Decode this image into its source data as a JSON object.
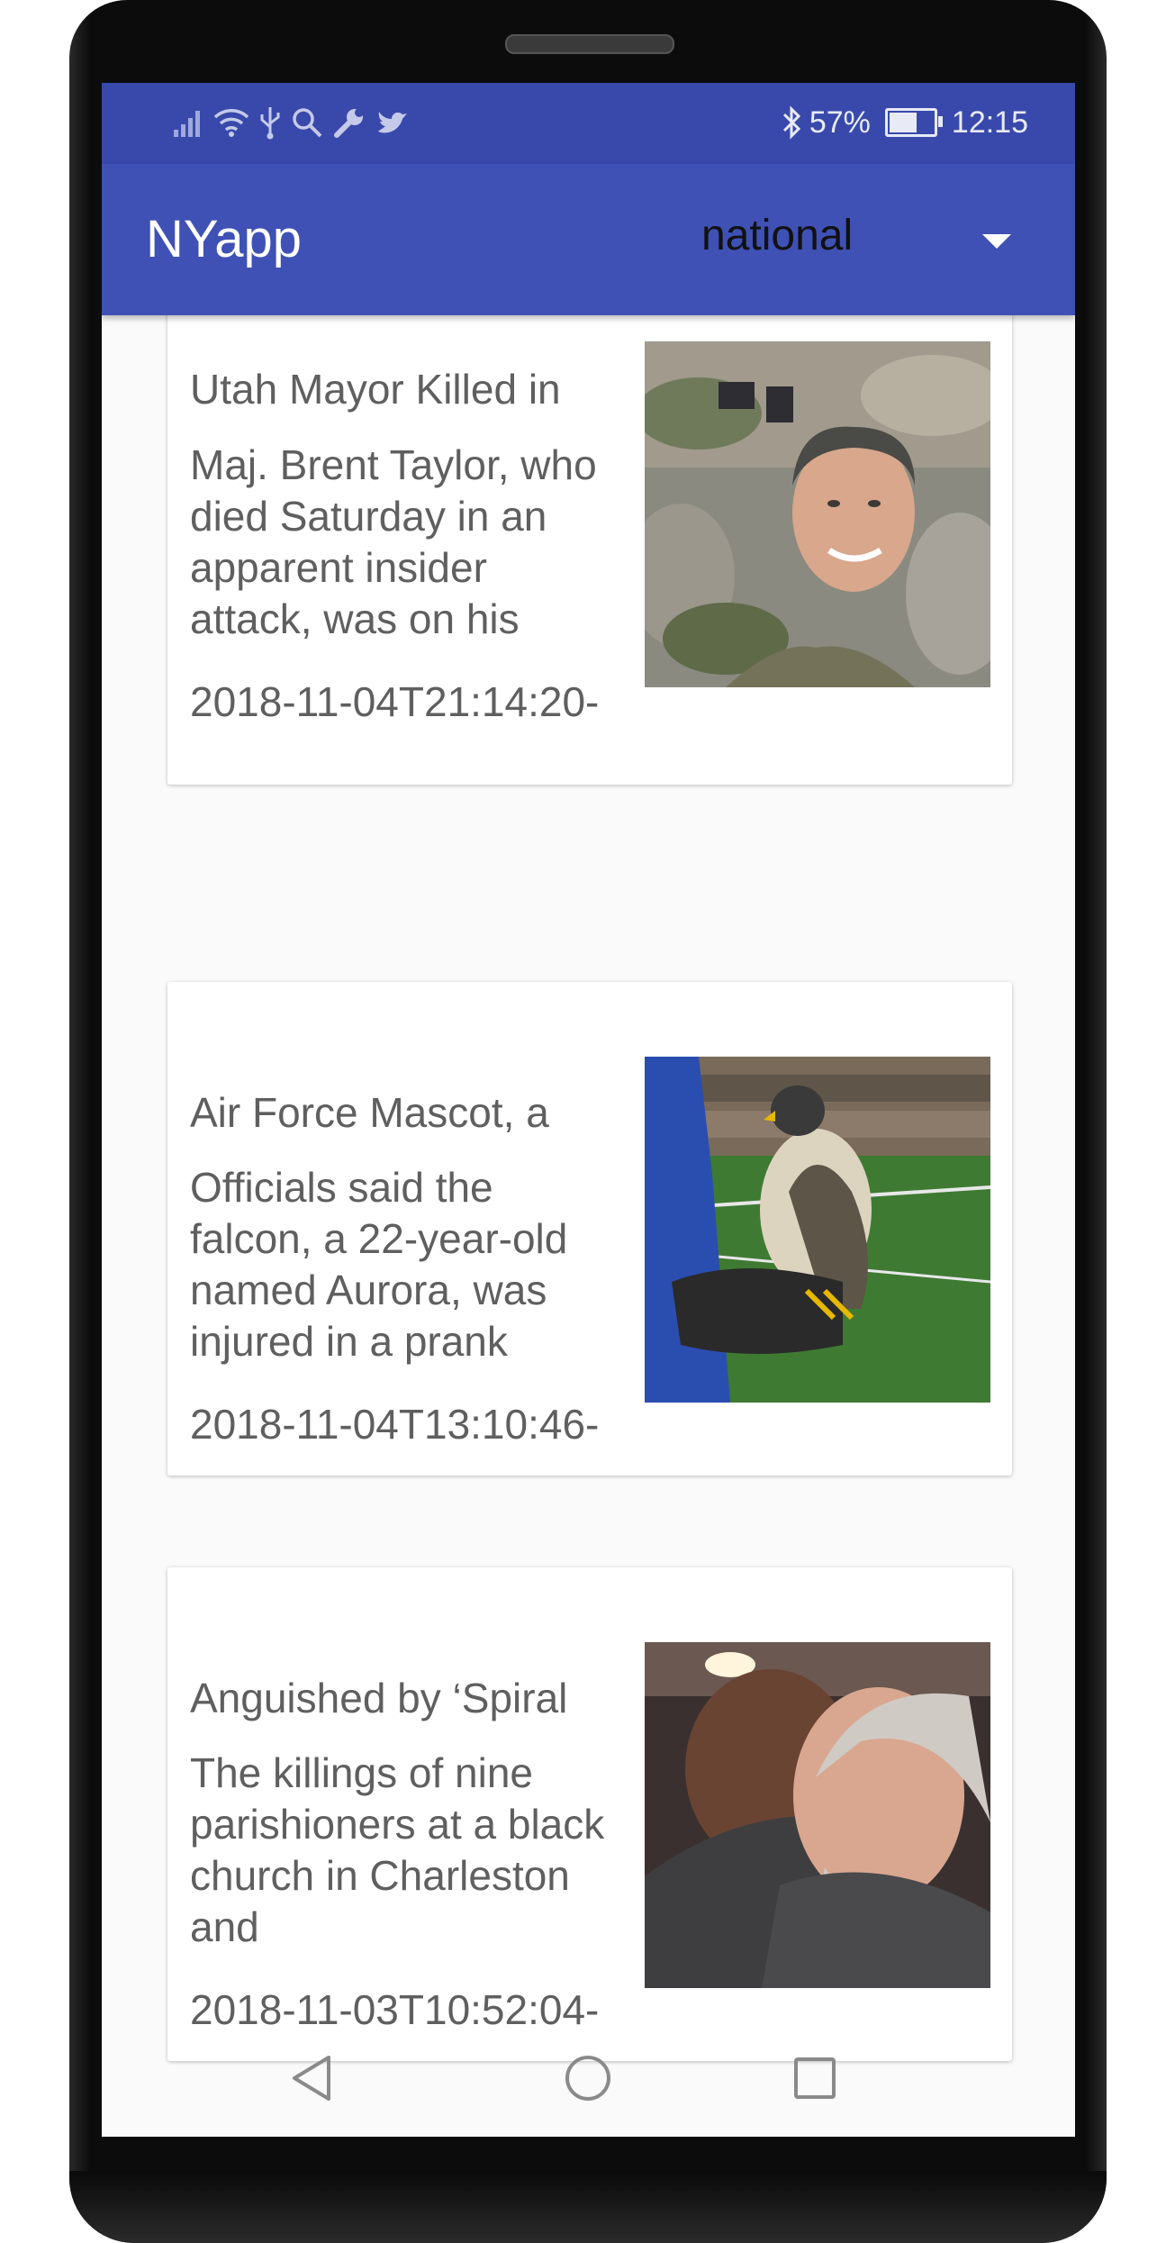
{
  "status_bar": {
    "battery_percent": "57%",
    "battery_level": 0.57,
    "time": "12:15",
    "left_icons": [
      "signal-icon",
      "wifi-icon",
      "usb-icon",
      "search-icon",
      "wrench-icon",
      "twitter-icon"
    ],
    "right_icons": [
      "bluetooth-icon",
      "battery-icon"
    ]
  },
  "app_bar": {
    "title": "NYapp",
    "section_value": "national"
  },
  "articles": [
    {
      "title": "Utah Mayor Killed in",
      "description": "Maj. Brent Taylor, who died Saturday in an apparent insider attack, was on his",
      "date": "2018-11-04T21:14:20-"
    },
    {
      "title": "Air Force Mascot, a",
      "description": "Officials said the falcon, a 22-year-old named Aurora, was injured in a prank",
      "date": "2018-11-04T13:10:46-"
    },
    {
      "title": "Anguished by ‘Spiral",
      "description": "The killings of nine parishioners at a black church in Charleston and",
      "date": "2018-11-03T10:52:04-"
    }
  ],
  "colors": {
    "status_bar": "#3949ab",
    "app_bar": "#3f51b5",
    "background": "#fafafa",
    "card": "#ffffff",
    "text": "#5f5f5f"
  },
  "nav_bar": {
    "buttons": [
      "back-icon",
      "home-icon",
      "recents-icon"
    ]
  }
}
